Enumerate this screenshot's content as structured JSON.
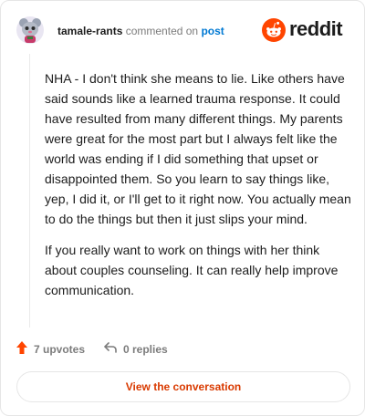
{
  "comment": {
    "username": "tamale-rants",
    "action": "commented on",
    "target": "post",
    "paragraphs": [
      "NHA - I don't think she means to lie. Like others have said sounds like a learned trauma response. It could have resulted from many different things. My parents were great for the most part but I always felt like the world was ending if I did something that upset or disappointed them. So you learn to say things like, yep, I did it, or I'll get to it right now. You actually mean to do the things but then it just slips your mind.",
      "If you really want to work on things with her think about couples counseling. It can really help improve communication."
    ],
    "upvotes": "7 upvotes",
    "replies": "0 replies"
  },
  "brand": {
    "wordmark": "reddit",
    "accent": "#ff4500",
    "cta_color": "#d93a00"
  },
  "cta": {
    "label": "View the conversation"
  },
  "icons": [
    "user-avatar",
    "reddit-logo-icon",
    "upvote-arrow-icon",
    "reply-arrow-icon"
  ]
}
